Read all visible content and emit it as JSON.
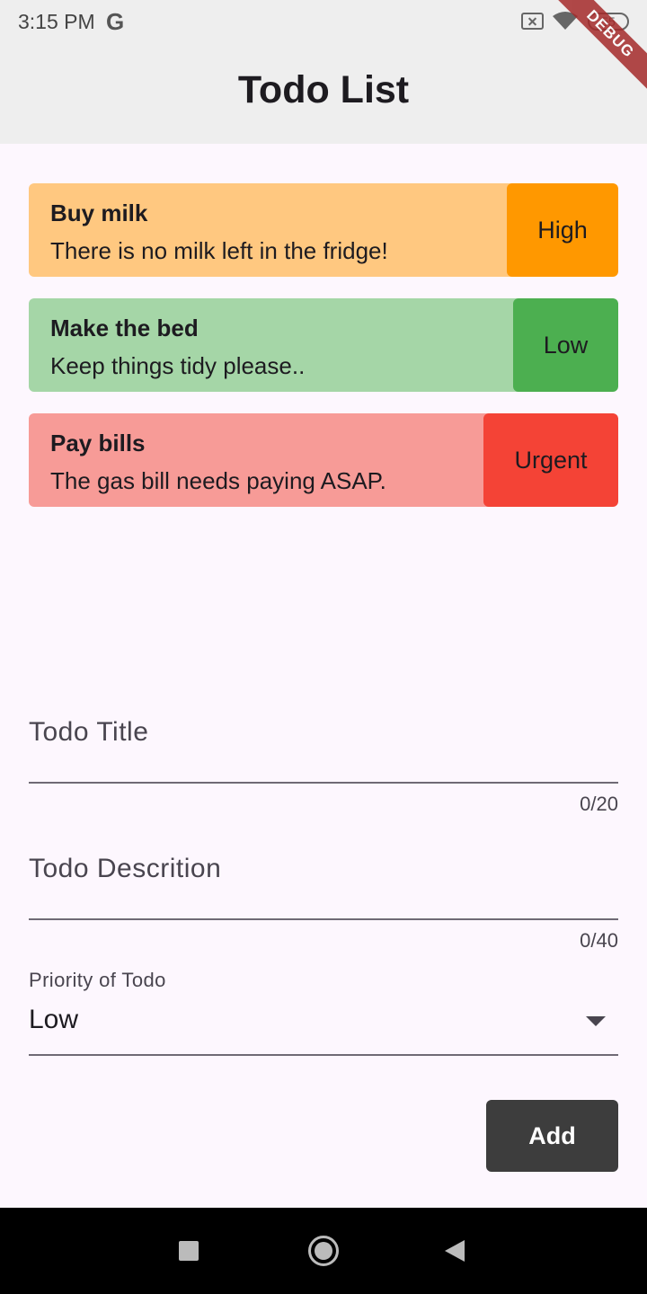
{
  "status_bar": {
    "time": "3:15 PM",
    "google_icon_letter": "G",
    "battery_level": "55",
    "icons": [
      "google-g-icon",
      "sim-off-icon",
      "wifi-icon",
      "battery-icon"
    ]
  },
  "app_bar": {
    "title": "Todo List"
  },
  "debug_banner": "DEBUG",
  "todos": [
    {
      "title": "Buy milk",
      "description": "There is no milk left in the fridge!",
      "priority": "High",
      "card_color": "#ffc880",
      "badge_color": "#ff9800"
    },
    {
      "title": "Make the bed",
      "description": "Keep things tidy please..",
      "priority": "Low",
      "card_color": "#a5d6a7",
      "badge_color": "#4caf50"
    },
    {
      "title": "Pay bills",
      "description": "The gas bill needs paying ASAP.",
      "priority": "Urgent",
      "card_color": "#f79b97",
      "badge_color": "#f44336"
    }
  ],
  "form": {
    "title_field": {
      "label": "Todo Title",
      "value": "",
      "counter": "0/20"
    },
    "description_field": {
      "label": "Todo Descrition",
      "value": "",
      "counter": "0/40"
    },
    "priority_field": {
      "label": "Priority of Todo",
      "selected": "Low"
    },
    "add_label": "Add"
  },
  "colors": {
    "app_bar_bg": "#eeeeee",
    "page_bg": "#fdf7fe",
    "button_bg": "#3d3d3d",
    "nav_bar_bg": "#000000"
  },
  "nav_bar": {
    "icons": [
      "recents-square-icon",
      "home-circle-icon",
      "back-triangle-icon"
    ]
  }
}
